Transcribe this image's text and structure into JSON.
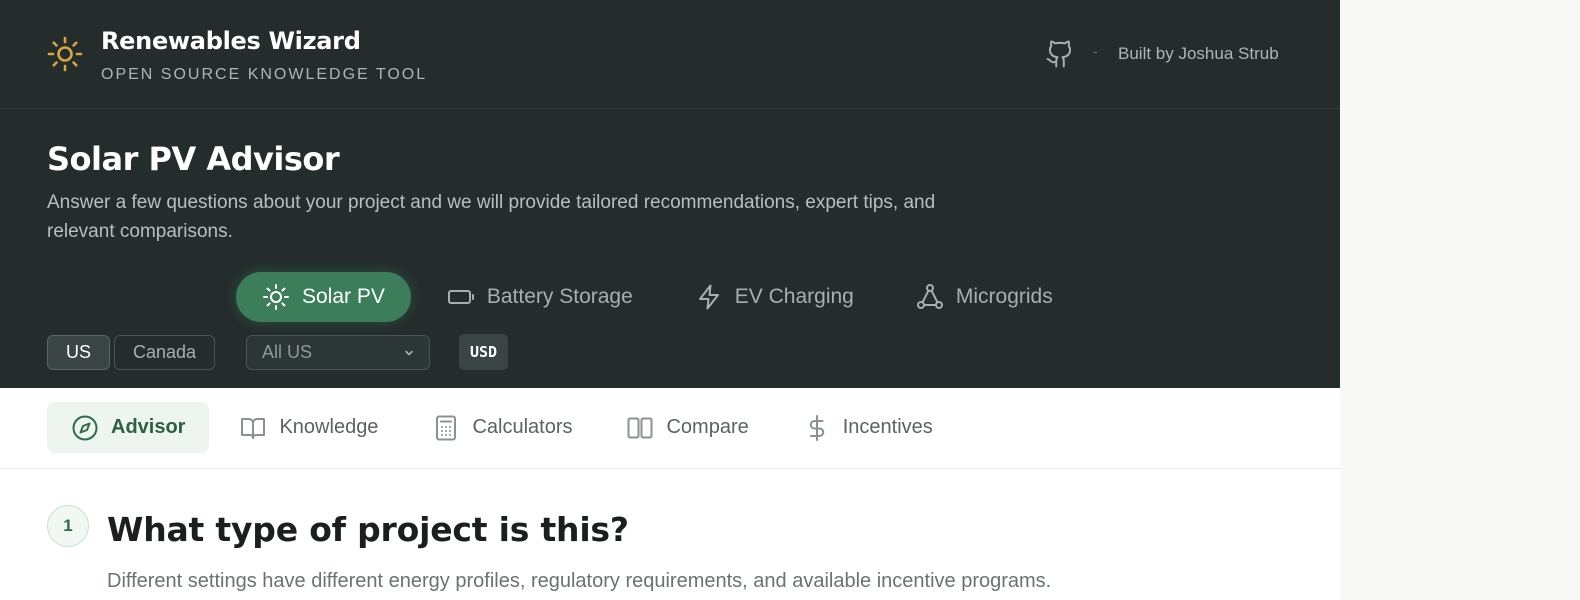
{
  "header": {
    "brand_title": "Renewables Wizard",
    "brand_subtitle": "OPEN SOURCE KNOWLEDGE TOOL",
    "brand_icon": "sun-icon",
    "github_icon": "github-icon",
    "separator": "-",
    "built_by": "Built by Joshua Strub"
  },
  "hero": {
    "title": "Solar PV Advisor",
    "description": "Answer a few questions about your project and we will provide tailored recommendations, expert tips, and relevant comparisons.",
    "tech_tabs": [
      {
        "label": "Solar PV",
        "icon": "sun-icon",
        "active": true
      },
      {
        "label": "Battery Storage",
        "icon": "battery-icon",
        "active": false
      },
      {
        "label": "EV Charging",
        "icon": "lightning-icon",
        "active": false
      },
      {
        "label": "Microgrids",
        "icon": "network-icon",
        "active": false
      }
    ],
    "countries": [
      {
        "label": "US",
        "active": true
      },
      {
        "label": "Canada",
        "active": false
      }
    ],
    "region": "All US",
    "currency": "USD"
  },
  "section_nav": [
    {
      "label": "Advisor",
      "icon": "compass-icon",
      "active": true
    },
    {
      "label": "Knowledge",
      "icon": "book-icon",
      "active": false
    },
    {
      "label": "Calculators",
      "icon": "calculator-icon",
      "active": false
    },
    {
      "label": "Compare",
      "icon": "columns-icon",
      "active": false
    },
    {
      "label": "Incentives",
      "icon": "dollar-icon",
      "active": false
    }
  ],
  "question": {
    "step": "1",
    "title": "What type of project is this?",
    "description": "Different settings have different energy profiles, regulatory requirements, and available incentive programs."
  },
  "colors": {
    "header_bg": "#242c2c",
    "accent_green": "#3c7e5a",
    "sun_yellow": "#d9a441",
    "active_nav_bg": "#eef5f0"
  }
}
